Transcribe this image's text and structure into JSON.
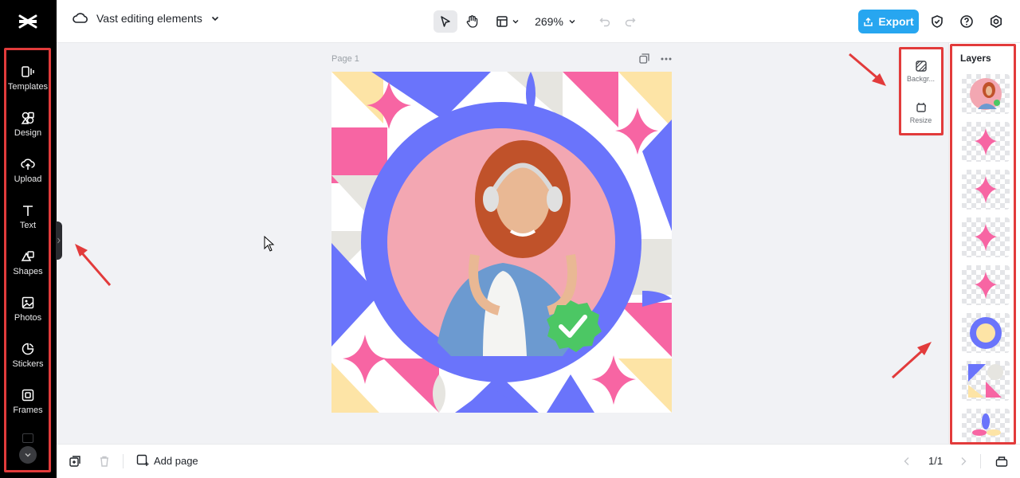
{
  "app": {
    "brand_color": "#000000",
    "accent": "#27a6f0"
  },
  "header": {
    "project_title": "Vast editing elements",
    "zoom": "269%",
    "export_label": "Export"
  },
  "sidebar": {
    "items": [
      {
        "label": "Templates",
        "icon": "templates-icon"
      },
      {
        "label": "Design",
        "icon": "design-icon"
      },
      {
        "label": "Upload",
        "icon": "upload-icon"
      },
      {
        "label": "Text",
        "icon": "text-icon"
      },
      {
        "label": "Shapes",
        "icon": "shapes-icon"
      },
      {
        "label": "Photos",
        "icon": "photos-icon"
      },
      {
        "label": "Stickers",
        "icon": "stickers-icon"
      },
      {
        "label": "Frames",
        "icon": "frames-icon"
      }
    ]
  },
  "canvas": {
    "page_label": "Page 1"
  },
  "float_tools": {
    "background_label": "Backgr...",
    "resize_label": "Resize"
  },
  "layers": {
    "title": "Layers",
    "items": [
      "photo",
      "star",
      "star",
      "star",
      "star",
      "ring",
      "shapes",
      "leaves"
    ]
  },
  "footer": {
    "add_page_label": "Add page",
    "pager": "1/1"
  },
  "annotation_color": "#e23b3b"
}
